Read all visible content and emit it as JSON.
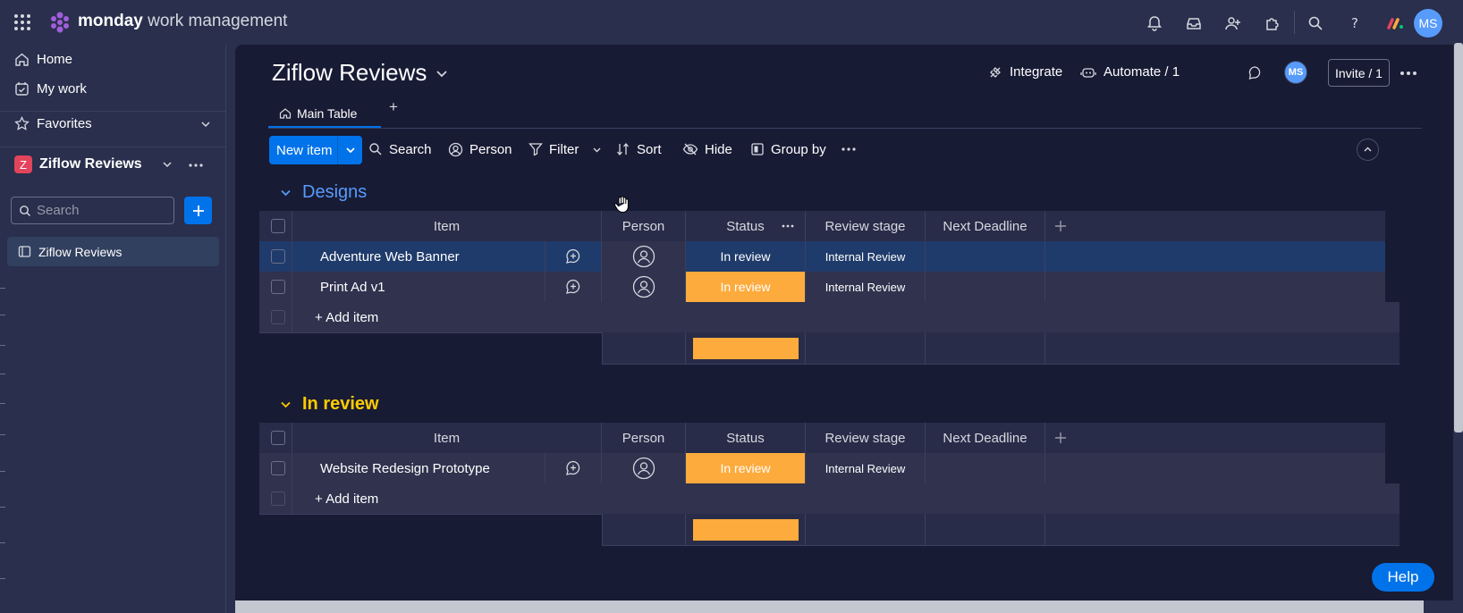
{
  "app": {
    "brand_bold": "monday",
    "brand_light": "work management"
  },
  "topbar": {
    "icons": [
      "notifications-icon",
      "inbox-icon",
      "invite-members-icon",
      "apps-icon",
      "search-icon",
      "help-icon",
      "product-switcher-icon"
    ],
    "avatar": "MS"
  },
  "sidebar": {
    "home": "Home",
    "my_work": "My work",
    "favorites": "Favorites",
    "workspace_badge": "Z",
    "workspace_name": "Ziflow Reviews",
    "search_placeholder": "Search",
    "board_item": "Ziflow Reviews"
  },
  "board": {
    "title": "Ziflow Reviews",
    "integrate": "Integrate",
    "automate": "Automate / 1",
    "avatar": "MS",
    "invite": "Invite / 1",
    "tab_main": "Main Table",
    "tab_add": "+"
  },
  "toolbar": {
    "new_item": "New item",
    "search": "Search",
    "person": "Person",
    "filter": "Filter",
    "sort": "Sort",
    "hide": "Hide",
    "group_by": "Group by"
  },
  "columns": {
    "item": "Item",
    "person": "Person",
    "status": "Status",
    "review_stage": "Review stage",
    "next_deadline": "Next Deadline"
  },
  "groups": [
    {
      "title": "Designs",
      "color": "#579bfc",
      "rows": [
        {
          "name": "Adventure Web Banner",
          "status": "In review",
          "stage": "Internal Review"
        },
        {
          "name": "Print Ad v1",
          "status": "In review",
          "stage": "Internal Review"
        }
      ],
      "add_item": "+ Add item"
    },
    {
      "title": "In review",
      "color": "#ffcb00",
      "rows": [
        {
          "name": "Website Redesign Prototype",
          "status": "In review",
          "stage": "Internal Review"
        }
      ],
      "add_item": "+ Add item"
    }
  ],
  "colors": {
    "status_in_review": "#fdab3d",
    "primary": "#0073ea"
  },
  "help": "Help"
}
